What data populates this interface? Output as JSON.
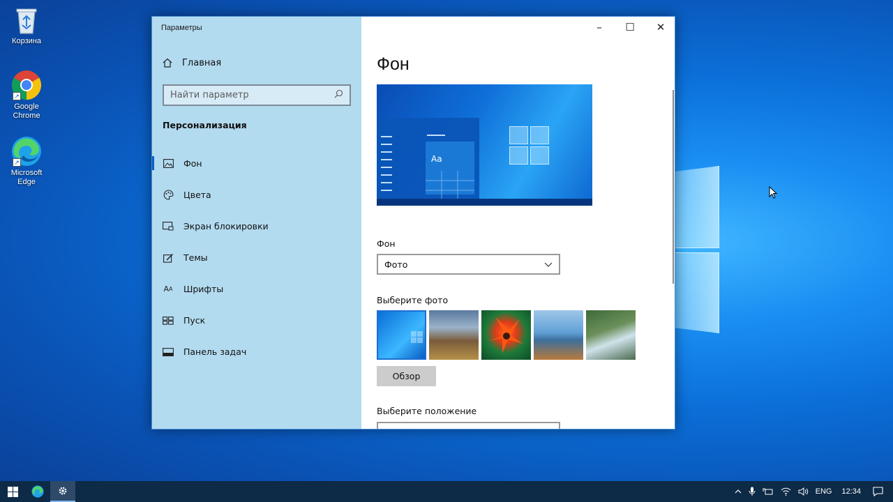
{
  "desktop": {
    "icons": [
      {
        "label": "Корзина"
      },
      {
        "label": "Google Chrome"
      },
      {
        "label": "Microsoft Edge"
      }
    ]
  },
  "window": {
    "title": "Параметры",
    "home_label": "Главная",
    "search_placeholder": "Найти параметр",
    "section_title": "Персонализация",
    "nav": [
      {
        "label": "Фон",
        "icon": "image-icon",
        "active": true
      },
      {
        "label": "Цвета",
        "icon": "palette-icon"
      },
      {
        "label": "Экран блокировки",
        "icon": "lockscreen-icon"
      },
      {
        "label": "Темы",
        "icon": "themes-icon"
      },
      {
        "label": "Шрифты",
        "icon": "fonts-icon"
      },
      {
        "label": "Пуск",
        "icon": "start-icon"
      },
      {
        "label": "Панель задач",
        "icon": "taskbar-icon"
      }
    ],
    "controls": {
      "minimize": "–",
      "maximize": "☐",
      "close": "✕"
    }
  },
  "content": {
    "page_title": "Фон",
    "preview_text": "Aa",
    "background_label": "Фон",
    "background_value": "Фото",
    "choose_photo_label": "Выберите фото",
    "browse_label": "Обзор",
    "position_label": "Выберите положение"
  },
  "taskbar": {
    "language": "ENG",
    "time": "12:34"
  },
  "colors": {
    "accent": "#0a5fc5",
    "sidebar": "#b3dbf0",
    "taskbar": "#0d2a47"
  }
}
